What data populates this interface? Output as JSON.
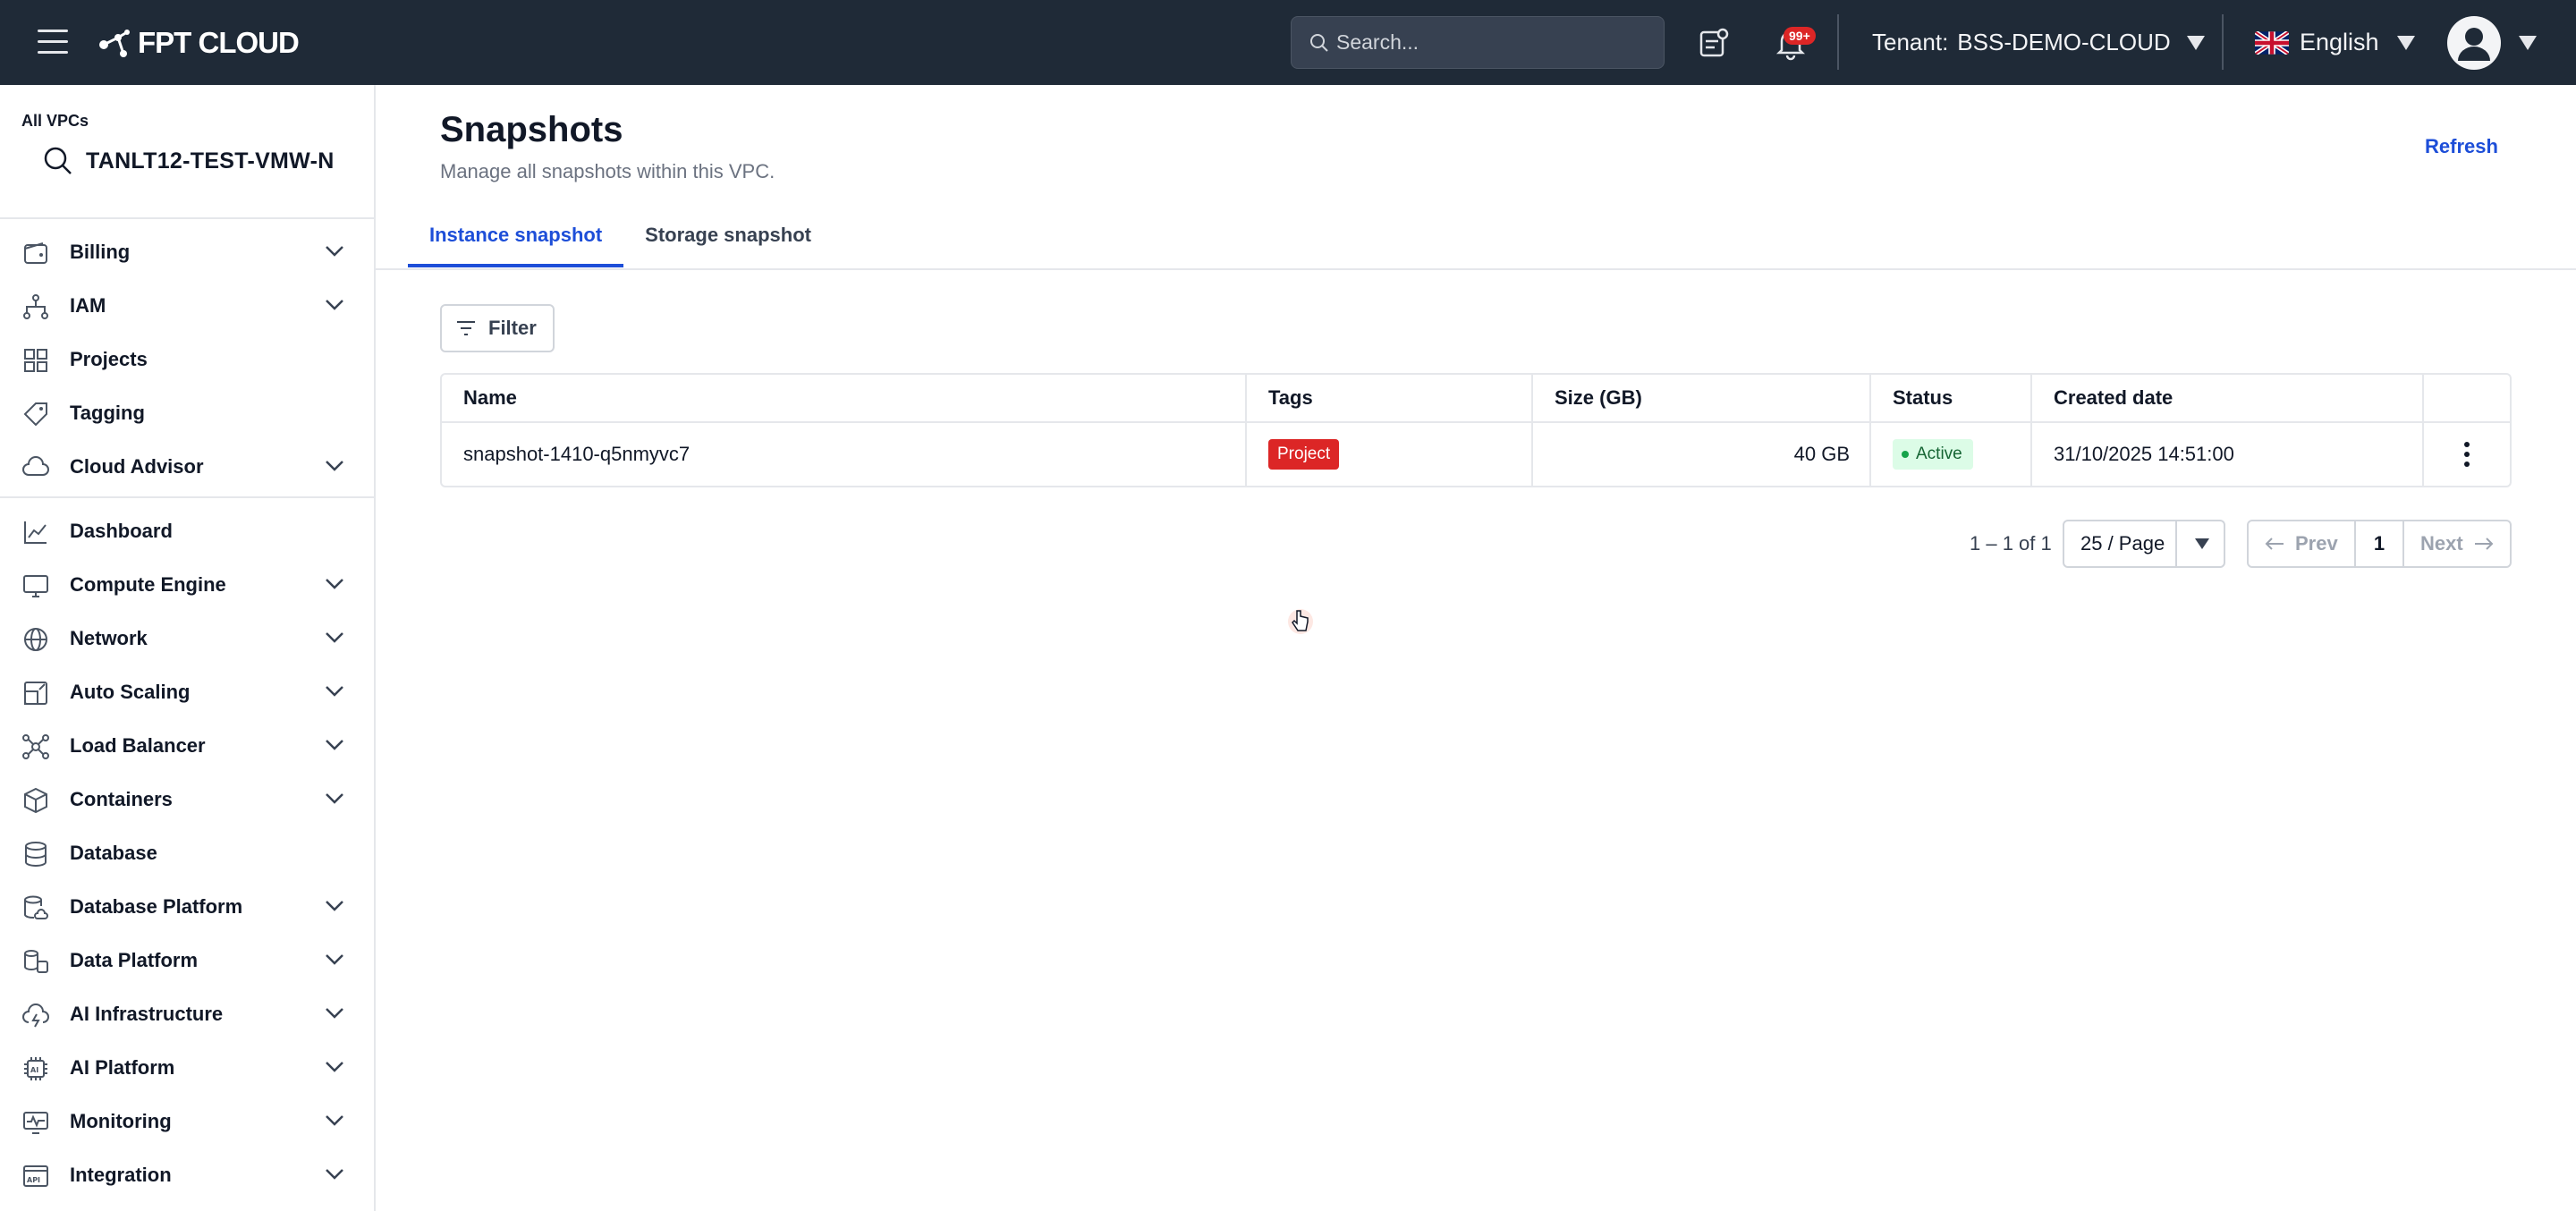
{
  "topbar": {
    "logo": "FPT CLOUD",
    "search_placeholder": "Search...",
    "notification_badge": "99+",
    "tenant_label": "Tenant:",
    "tenant_value": "BSS-DEMO-CLOUD",
    "language": "English"
  },
  "sidebar": {
    "vpc_label": "All VPCs",
    "vpc_name": "TANLT12-TEST-VMW-N",
    "items": [
      {
        "label": "Billing",
        "icon": "wallet-icon",
        "expandable": true
      },
      {
        "label": "IAM",
        "icon": "hierarchy-icon",
        "expandable": true
      },
      {
        "label": "Projects",
        "icon": "grid-icon",
        "expandable": false
      },
      {
        "label": "Tagging",
        "icon": "tag-icon",
        "expandable": false
      },
      {
        "label": "Cloud Advisor",
        "icon": "cloud-icon",
        "expandable": true
      },
      {
        "label": "Dashboard",
        "icon": "chart-icon",
        "expandable": false
      },
      {
        "label": "Compute Engine",
        "icon": "monitor-icon",
        "expandable": true
      },
      {
        "label": "Network",
        "icon": "globe-icon",
        "expandable": true
      },
      {
        "label": "Auto Scaling",
        "icon": "scaling-icon",
        "expandable": true
      },
      {
        "label": "Load Balancer",
        "icon": "nodes-icon",
        "expandable": true
      },
      {
        "label": "Containers",
        "icon": "box-icon",
        "expandable": true
      },
      {
        "label": "Database",
        "icon": "database-icon",
        "expandable": false
      },
      {
        "label": "Database Platform",
        "icon": "database-cloud-icon",
        "expandable": true
      },
      {
        "label": "Data Platform",
        "icon": "data-stack-icon",
        "expandable": true
      },
      {
        "label": "AI Infrastructure",
        "icon": "ai-cloud-icon",
        "expandable": true
      },
      {
        "label": "AI Platform",
        "icon": "ai-chip-icon",
        "expandable": true
      },
      {
        "label": "Monitoring",
        "icon": "pulse-icon",
        "expandable": true
      },
      {
        "label": "Integration",
        "icon": "api-icon",
        "expandable": true
      }
    ]
  },
  "main": {
    "title": "Snapshots",
    "subtitle": "Manage all snapshots within this VPC.",
    "refresh_label": "Refresh",
    "tabs": [
      {
        "label": "Instance snapshot",
        "active": true
      },
      {
        "label": "Storage snapshot",
        "active": false
      }
    ],
    "filter_label": "Filter",
    "table": {
      "columns": [
        "Name",
        "Tags",
        "Size (GB)",
        "Status",
        "Created date"
      ],
      "rows": [
        {
          "name": "snapshot-1410-q5nmyvc7",
          "tag": "Project",
          "size": "40 GB",
          "status": "Active",
          "created": "31/10/2025 14:51:00"
        }
      ]
    },
    "pagination": {
      "count_text": "1 – 1 of 1",
      "page_size": "25 / Page",
      "prev_label": "Prev",
      "current_page": "1",
      "next_label": "Next"
    }
  },
  "colors": {
    "topbar_bg": "#1f2a37",
    "accent": "#1d4ed8",
    "tag_project": "#dc2626",
    "status_active_bg": "#dcfce7",
    "status_active_text": "#166534"
  }
}
